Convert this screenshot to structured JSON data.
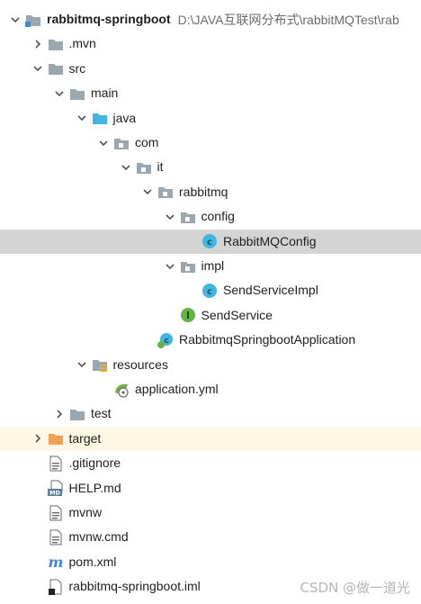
{
  "tree": [
    {
      "label": "rabbitmq-springboot",
      "path": "D:\\JAVA互联网分布式\\rabbitMQTest\\rab",
      "bold": true,
      "indent": 0,
      "arrow": "down",
      "icon": "module-folder-icon"
    },
    {
      "label": ".mvn",
      "indent": 1,
      "arrow": "right",
      "icon": "folder-icon"
    },
    {
      "label": "src",
      "indent": 1,
      "arrow": "down",
      "icon": "folder-icon"
    },
    {
      "label": "main",
      "indent": 2,
      "arrow": "down",
      "icon": "folder-icon"
    },
    {
      "label": "java",
      "indent": 3,
      "arrow": "down",
      "icon": "source-folder-icon"
    },
    {
      "label": "com",
      "indent": 4,
      "arrow": "down",
      "icon": "package-icon"
    },
    {
      "label": "it",
      "indent": 5,
      "arrow": "down",
      "icon": "package-icon"
    },
    {
      "label": "rabbitmq",
      "indent": 6,
      "arrow": "down",
      "icon": "package-icon"
    },
    {
      "label": "config",
      "indent": 7,
      "arrow": "down",
      "icon": "package-icon"
    },
    {
      "label": "RabbitMQConfig",
      "indent": 8,
      "arrow": "none",
      "icon": "class-icon",
      "selected": true
    },
    {
      "label": "impl",
      "indent": 7,
      "arrow": "down",
      "icon": "package-icon"
    },
    {
      "label": "SendServiceImpl",
      "indent": 8,
      "arrow": "none",
      "icon": "class-icon"
    },
    {
      "label": "SendService",
      "indent": 7,
      "arrow": "none",
      "icon": "interface-icon"
    },
    {
      "label": "RabbitmqSpringbootApplication",
      "indent": 6,
      "arrow": "none",
      "icon": "spring-boot-class-icon"
    },
    {
      "label": "resources",
      "indent": 3,
      "arrow": "down",
      "icon": "resources-folder-icon"
    },
    {
      "label": "application.yml",
      "indent": 4,
      "arrow": "none",
      "icon": "spring-yml-icon"
    },
    {
      "label": "test",
      "indent": 2,
      "arrow": "right",
      "icon": "folder-icon"
    },
    {
      "label": "target",
      "indent": 1,
      "arrow": "right",
      "icon": "excluded-folder-icon",
      "excluded": true
    },
    {
      "label": ".gitignore",
      "indent": 1,
      "arrow": "none",
      "icon": "text-file-icon"
    },
    {
      "label": "HELP.md",
      "indent": 1,
      "arrow": "none",
      "icon": "markdown-file-icon"
    },
    {
      "label": "mvnw",
      "indent": 1,
      "arrow": "none",
      "icon": "text-file-icon"
    },
    {
      "label": "mvnw.cmd",
      "indent": 1,
      "arrow": "none",
      "icon": "text-file-icon"
    },
    {
      "label": "pom.xml",
      "indent": 1,
      "arrow": "none",
      "icon": "maven-icon"
    },
    {
      "label": "rabbitmq-springboot.iml",
      "indent": 1,
      "arrow": "none",
      "icon": "iml-file-icon"
    }
  ],
  "watermark": "CSDN @做一道光",
  "colors": {
    "selection": "#d4d4d4",
    "excluded_row": "#fdf7e3",
    "folder": "#9aa7b0",
    "source_folder": "#40b6e0",
    "excluded_folder": "#f0a050",
    "class": "#40b6e0",
    "interface": "#62b543"
  }
}
